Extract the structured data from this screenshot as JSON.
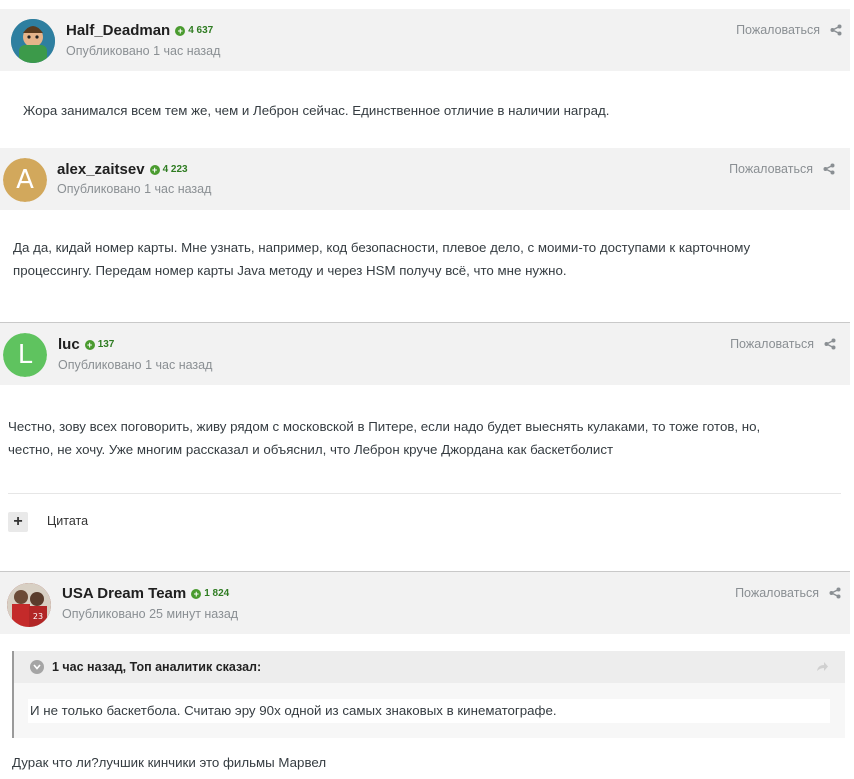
{
  "posts": [
    {
      "author": "Half_Deadman",
      "reputation": "4 637",
      "published": "Опубликовано 1 час назад",
      "report": "Пожаловаться",
      "avatar": {
        "type": "image",
        "color": "#3a8a4a"
      },
      "body": "Жора занимался всем тем же, чем и Леброн сейчас.  Единственное отличие в  наличии наград."
    },
    {
      "author": "alex_zaitsev",
      "reputation": "4 223",
      "published": "Опубликовано 1 час назад",
      "report": "Пожаловаться",
      "avatar": {
        "type": "letter",
        "letter": "A",
        "color": "#d2a85c"
      },
      "body_lines": [
        "Да да, кидай номер карты. Мне узнать, например, код безопасности, плевое дело, с моими-то доступами к карточному",
        "процессингу. Передам номер карты Java методу и через HSM получу всё, что мне нужно."
      ]
    },
    {
      "author": "luc",
      "reputation": "137",
      "published": "Опубликовано 1 час назад",
      "report": "Пожаловаться",
      "avatar": {
        "type": "letter",
        "letter": "L",
        "color": "#5fc35f"
      },
      "body_lines": [
        "Честно, зову всех поговорить, живу рядом с московской в Питере, если надо будет выеснять кулаками, то тоже готов, но,",
        "честно, не хочу. Уже многим рассказал и объяснил, что Леброн круче Джордана как баскетболист"
      ],
      "quote_button": "Цитата"
    },
    {
      "author": "USA Dream Team",
      "reputation": "1 824",
      "published": "Опубликовано 25 минут назад",
      "report": "Пожаловаться",
      "avatar": {
        "type": "image",
        "color": "#b02a2a"
      },
      "quote": {
        "title": "1 час назад, Топ аналитик сказал:",
        "text": "И не только баскетбола. Считаю эру 90х одной из самых знаковых в кинематографе."
      },
      "body": "Дурак что ли?лучшик кинчики это фильмы Марвел"
    }
  ],
  "colors": {
    "rep_green": "#4a9b2f",
    "header_bg": "#f2f2f2",
    "meta_gray": "#8a8f93"
  }
}
